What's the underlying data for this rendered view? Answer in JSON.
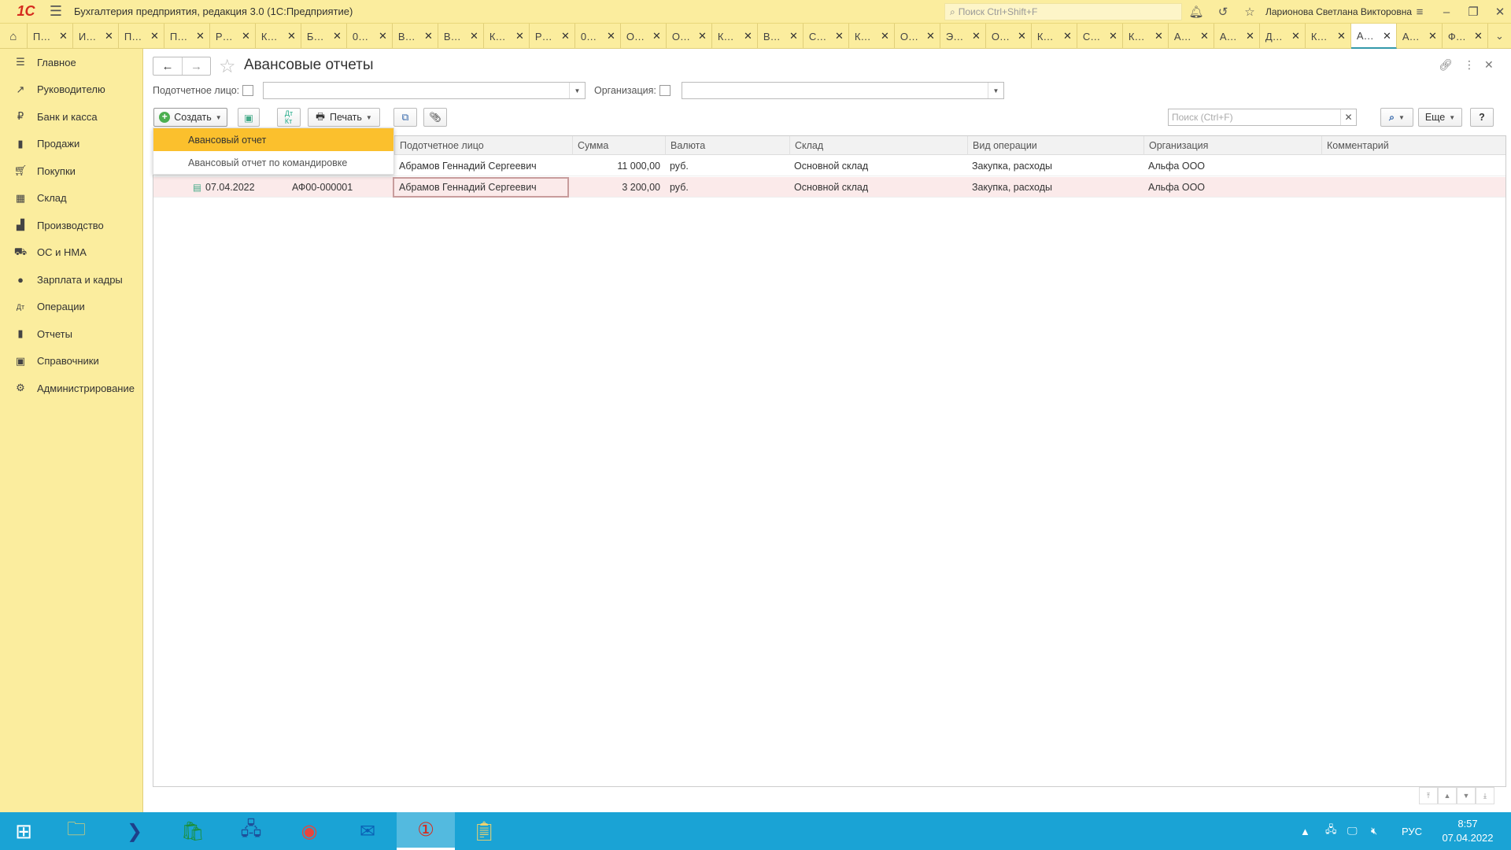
{
  "app": {
    "logo_text": "1С",
    "title": "Бухгалтерия предприятия, редакция 3.0  (1С:Предприятие)",
    "global_search_placeholder": "Поиск Ctrl+Shift+F",
    "user_name": "Ларионова Светлана Викторовна"
  },
  "tabs": [
    {
      "label": "П…"
    },
    {
      "label": "И…"
    },
    {
      "label": "П…"
    },
    {
      "label": "П…"
    },
    {
      "label": "Р…"
    },
    {
      "label": "К…"
    },
    {
      "label": "Б…"
    },
    {
      "label": "0…"
    },
    {
      "label": "В…"
    },
    {
      "label": "В…"
    },
    {
      "label": "К…"
    },
    {
      "label": "Р…"
    },
    {
      "label": "0…"
    },
    {
      "label": "О…"
    },
    {
      "label": "О…"
    },
    {
      "label": "К…"
    },
    {
      "label": "В…"
    },
    {
      "label": "С…"
    },
    {
      "label": "К…"
    },
    {
      "label": "О…"
    },
    {
      "label": "Э…"
    },
    {
      "label": "О…"
    },
    {
      "label": "К…"
    },
    {
      "label": "С…"
    },
    {
      "label": "К…"
    },
    {
      "label": "А…"
    },
    {
      "label": "А…"
    },
    {
      "label": "Д…"
    },
    {
      "label": "К…"
    },
    {
      "label": "А…",
      "active": true
    },
    {
      "label": "А…"
    },
    {
      "label": "Ф…"
    }
  ],
  "sidebar": {
    "items": [
      {
        "icon": "menu-icon",
        "label": "Главное"
      },
      {
        "icon": "trend-icon",
        "label": "Руководителю"
      },
      {
        "icon": "ruble-icon",
        "label": "Банк и касса"
      },
      {
        "icon": "bag-icon",
        "label": "Продажи"
      },
      {
        "icon": "cart-icon",
        "label": "Покупки"
      },
      {
        "icon": "grid-icon",
        "label": "Склад"
      },
      {
        "icon": "factory-icon",
        "label": "Производство"
      },
      {
        "icon": "truck-icon",
        "label": "ОС и НМА"
      },
      {
        "icon": "person-icon",
        "label": "Зарплата и кадры"
      },
      {
        "icon": "dtkt-icon",
        "label": "Операции"
      },
      {
        "icon": "bar-chart-icon",
        "label": "Отчеты"
      },
      {
        "icon": "book-icon",
        "label": "Справочники"
      },
      {
        "icon": "gear-icon",
        "label": "Администрирование"
      }
    ]
  },
  "page": {
    "title": "Авансовые отчеты",
    "filters": {
      "person_label": "Подотчетное лицо:",
      "org_label": "Организация:"
    },
    "toolbar": {
      "create_label": "Создать",
      "print_label": "Печать",
      "search_placeholder": "Поиск (Ctrl+F)",
      "more_label": "Еще",
      "help_label": "?"
    },
    "create_menu": [
      {
        "label": "Авансовый отчет",
        "selected": true
      },
      {
        "label": "Авансовый отчет по командировке"
      }
    ],
    "table": {
      "columns": [
        "Подотчетное лицо",
        "Сумма",
        "Валюта",
        "Склад",
        "Вид операции",
        "Организация",
        "Комментарий"
      ],
      "rows": [
        {
          "date": "",
          "number": "",
          "person": "Абрамов Геннадий Сергеевич",
          "sum": "11 000,00",
          "currency": "руб.",
          "warehouse": "Основной склад",
          "operation": "Закупка, расходы",
          "org": "Альфа ООО",
          "comment": ""
        },
        {
          "date": "07.04.2022",
          "number": "АФ00-000001",
          "person": "Абрамов Геннадий Сергеевич",
          "sum": "3 200,00",
          "currency": "руб.",
          "warehouse": "Основной склад",
          "operation": "Закупка, расходы",
          "org": "Альфа ООО",
          "comment": ""
        }
      ]
    }
  },
  "taskbar": {
    "lang": "РУС",
    "time": "8:57",
    "date": "07.04.2022"
  },
  "colors": {
    "panel_yellow": "#fbed9e",
    "menu_highlight": "#fbc02d",
    "taskbar_blue": "#1aa3d5",
    "selected_row": "#fbeaea"
  }
}
